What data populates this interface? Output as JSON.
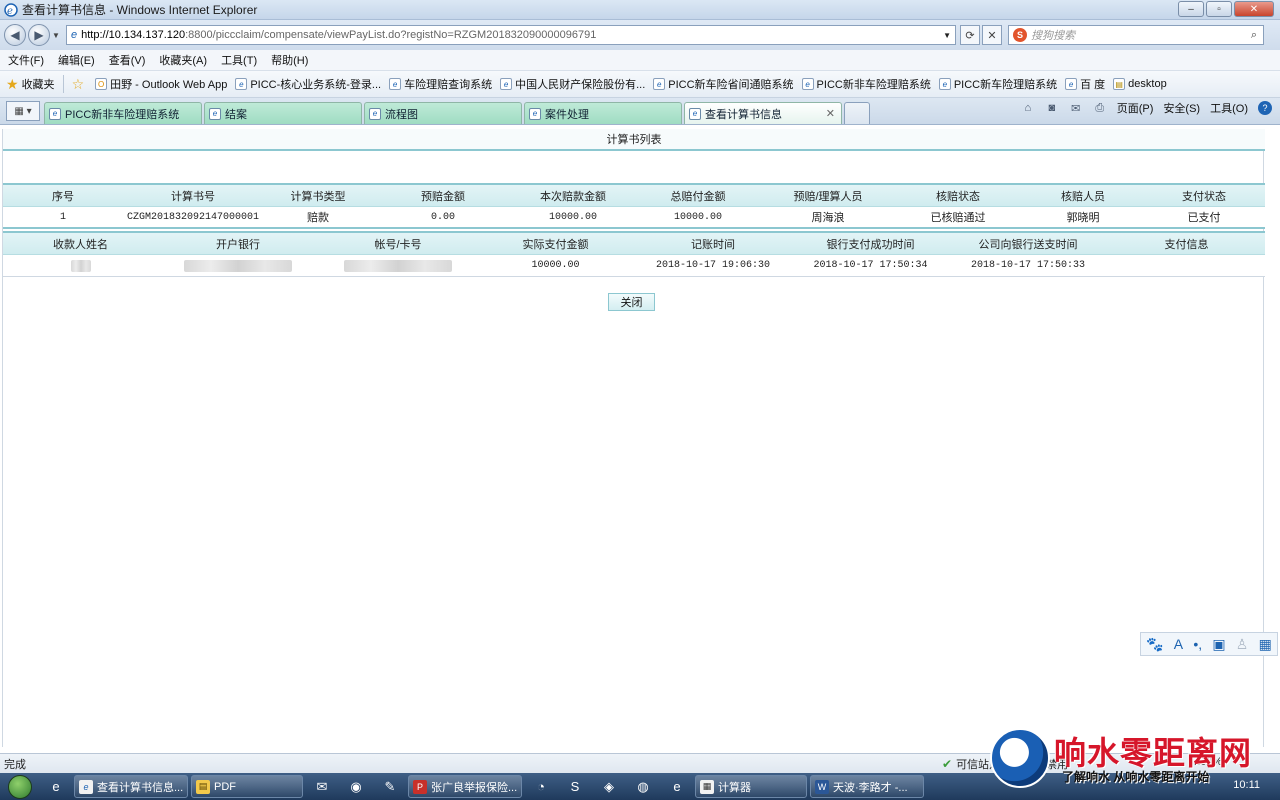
{
  "window": {
    "title": "查看计算书信息 - Windows Internet Explorer"
  },
  "address": {
    "url_host": "http://10.134.137.120",
    "url_path": ":8800/piccclaim/compensate/viewPayList.do?registNo=RZGM201832090000096791",
    "search_placeholder": "搜狗搜索"
  },
  "menu": [
    "文件(F)",
    "编辑(E)",
    "查看(V)",
    "收藏夹(A)",
    "工具(T)",
    "帮助(H)"
  ],
  "favorites": {
    "label": "收藏夹",
    "items": [
      "田野 - Outlook Web App",
      "PICC-核心业务系统-登录...",
      "车险理赔查询系统",
      "中国人民财产保险股份有...",
      "PICC新车险省间通赔系统",
      "PICC新非车险理赔系统",
      "PICC新车险理赔系统",
      "百 度",
      "desktop"
    ]
  },
  "tabs": [
    {
      "label": "PICC新非车险理赔系统"
    },
    {
      "label": "结案"
    },
    {
      "label": "流程图"
    },
    {
      "label": "案件处理"
    },
    {
      "label": "查看计算书信息"
    }
  ],
  "commandbar": {
    "page": "页面(P)",
    "safety": "安全(S)",
    "tools": "工具(O)"
  },
  "page": {
    "list_title": "计算书列表",
    "table1_headers": [
      "序号",
      "计算书号",
      "计算书类型",
      "预赔金额",
      "本次赔款金额",
      "总赔付金额",
      "预赔/理算人员",
      "核赔状态",
      "核赔人员",
      "支付状态"
    ],
    "table1_row": [
      "1",
      "CZGM201832092147000001",
      "赔款",
      "0.00",
      "10000.00",
      "10000.00",
      "周海浪",
      "已核赔通过",
      "郭晓明",
      "已支付"
    ],
    "table2_headers": [
      "收款人姓名",
      "开户银行",
      "帐号/卡号",
      "实际支付金额",
      "记账时间",
      "银行支付成功时间",
      "公司向银行送支时间",
      "支付信息"
    ],
    "table2_row": [
      "",
      "",
      "",
      "10000.00",
      "2018-10-17 19:06:30",
      "2018-10-17 17:50:34",
      "2018-10-17 17:50:33",
      ""
    ],
    "close_label": "关闭"
  },
  "status": {
    "left": "完成",
    "zone": "可信站点",
    "protected": "禁用",
    "zoom": "100%"
  },
  "taskbar": {
    "items": [
      "查看计算书信息...",
      "PDF",
      "张广良举报保险...",
      "计算器",
      "天波·李路才 -..."
    ],
    "clock": "10:11"
  },
  "watermark": {
    "brand": "响水零距离网",
    "slogan": "了解响水 从响水零距离开始"
  }
}
